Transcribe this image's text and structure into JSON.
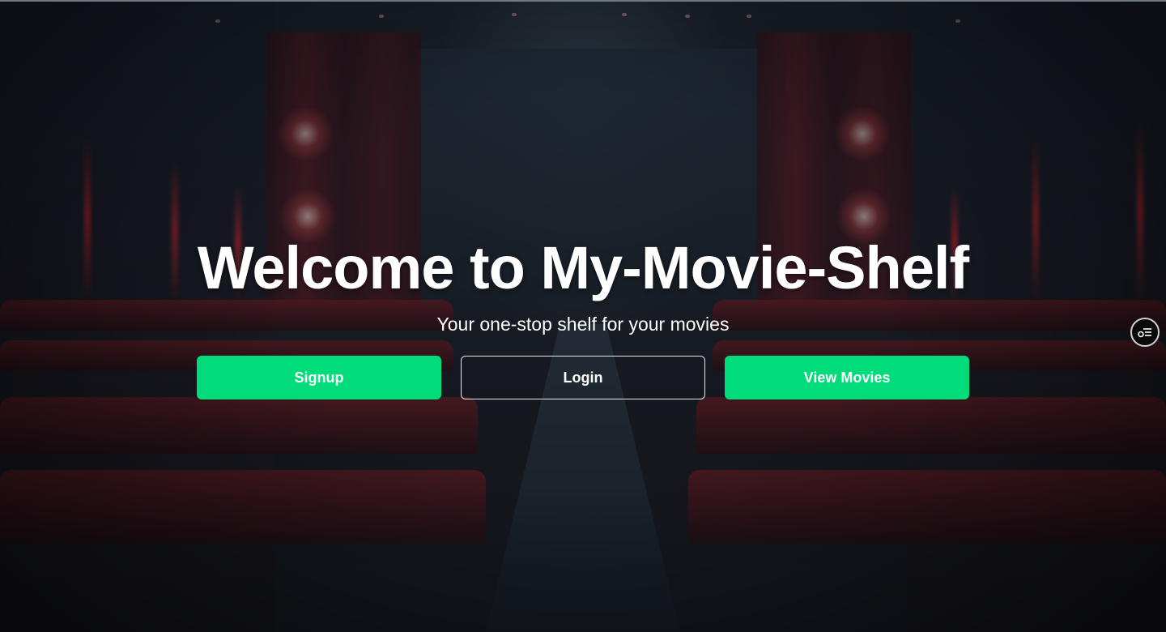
{
  "hero": {
    "title": "Welcome to My-Movie-Shelf",
    "subtitle": "Your one-stop shelf for your movies"
  },
  "actions": {
    "signup_label": "Signup",
    "login_label": "Login",
    "view_movies_label": "View Movies"
  },
  "colors": {
    "accent": "#00dc7a",
    "outline_border": "#e8e8e8"
  },
  "floating_widget": {
    "icon": "menu-settings-icon"
  }
}
